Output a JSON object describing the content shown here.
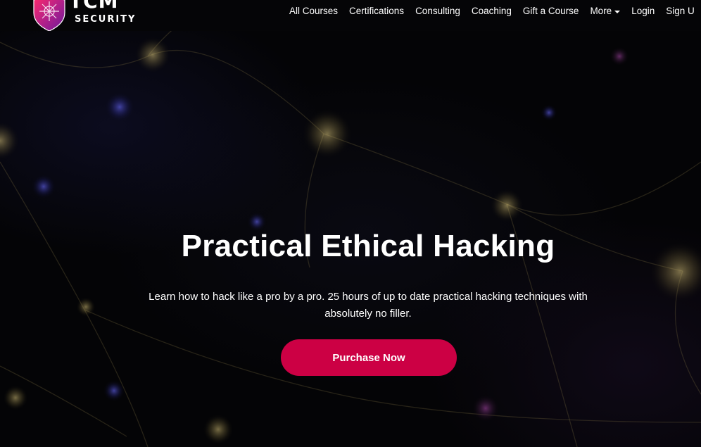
{
  "logo": {
    "main": "TCM",
    "sub": "SECURITY"
  },
  "nav": {
    "items": [
      {
        "label": "All Courses"
      },
      {
        "label": "Certifications"
      },
      {
        "label": "Consulting"
      },
      {
        "label": "Coaching"
      },
      {
        "label": "Gift a Course"
      },
      {
        "label": "More"
      },
      {
        "label": "Login"
      },
      {
        "label": "Sign U"
      }
    ]
  },
  "hero": {
    "title": "Practical Ethical Hacking",
    "subtitle": "Learn how to hack like a pro by a pro. 25 hours of up to date practical hacking techniques with absolutely no filler.",
    "cta": "Purchase Now"
  },
  "colors": {
    "accent": "#cc0044",
    "background": "#040406",
    "text": "#ffffff"
  }
}
